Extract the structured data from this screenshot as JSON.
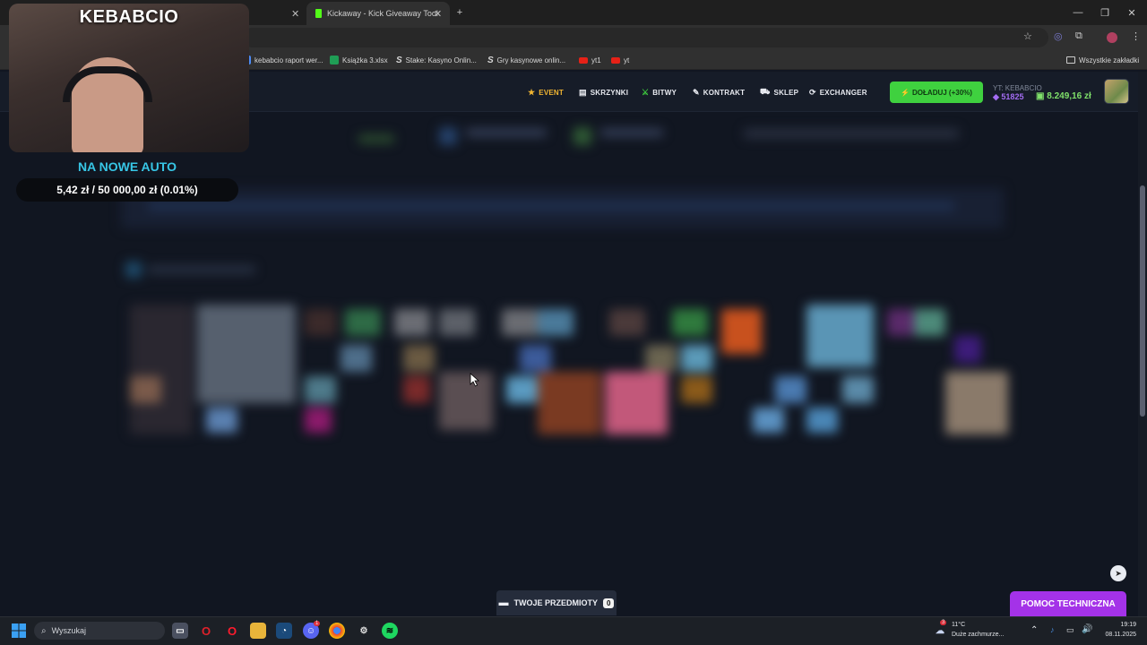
{
  "browser": {
    "tabs": [
      {
        "title": "",
        "active": false
      },
      {
        "title": "Kickaway - Kick Giveaway Tool",
        "active": true
      }
    ],
    "new_tab_symbol": "+",
    "bookmarks": [
      {
        "label": "kebabcio raport wer...",
        "icon": "doc-icon"
      },
      {
        "label": "Książka 3.xlsx",
        "icon": "excel-icon"
      },
      {
        "label": "Stake: Kasyno Onlin...",
        "icon": "stake-icon"
      },
      {
        "label": "Gry kasynowe onlin...",
        "icon": "stake-icon"
      },
      {
        "label": "yt1",
        "icon": "youtube-icon"
      },
      {
        "label": "yt",
        "icon": "youtube-icon"
      }
    ],
    "all_bookmarks": "Wszystkie zakładki"
  },
  "site": {
    "nav": [
      {
        "label": "EVENT",
        "icon": "star-icon",
        "color": "#f2b632"
      },
      {
        "label": "SKRZYNKI",
        "icon": "box-icon",
        "color": "#e8eaf0"
      },
      {
        "label": "BITWY",
        "icon": "swords-icon",
        "color": "#e8eaf0"
      },
      {
        "label": "KONTRAKT",
        "icon": "pen-icon",
        "color": "#e8eaf0"
      },
      {
        "label": "SKLEP",
        "icon": "cart-icon",
        "color": "#e8eaf0"
      },
      {
        "label": "EXCHANGER",
        "icon": "exchange-icon",
        "color": "#e8eaf0"
      }
    ],
    "topup_label": "DOŁADUJ (+30%)",
    "user_label": "YT: KEBABCIO",
    "coins": "51825",
    "balance": "8.249,16 zł",
    "items_label": "TWOJE PRZEDMIOTY",
    "items_count": "0",
    "support_label": "POMOC TECHNICZNA"
  },
  "stream_overlay": {
    "name": "KEBABCIO",
    "goal_title": "NA NOWE AUTO",
    "goal_progress": "5,42 zł / 50 000,00 zł (0.01%)",
    "goal_fraction": 0.0001
  },
  "taskbar": {
    "search_placeholder": "Wyszukaj",
    "weather_temp": "11°C",
    "weather_desc": "Duże zachmurze...",
    "weather_badge": "3",
    "discord_badge": "1",
    "time": "19:19",
    "date": "08.11.2025"
  },
  "colors": {
    "accent_green": "#3fd13f",
    "accent_purple": "#a432e8",
    "goal_cyan": "#37c6e6",
    "page_bg": "#111621"
  }
}
